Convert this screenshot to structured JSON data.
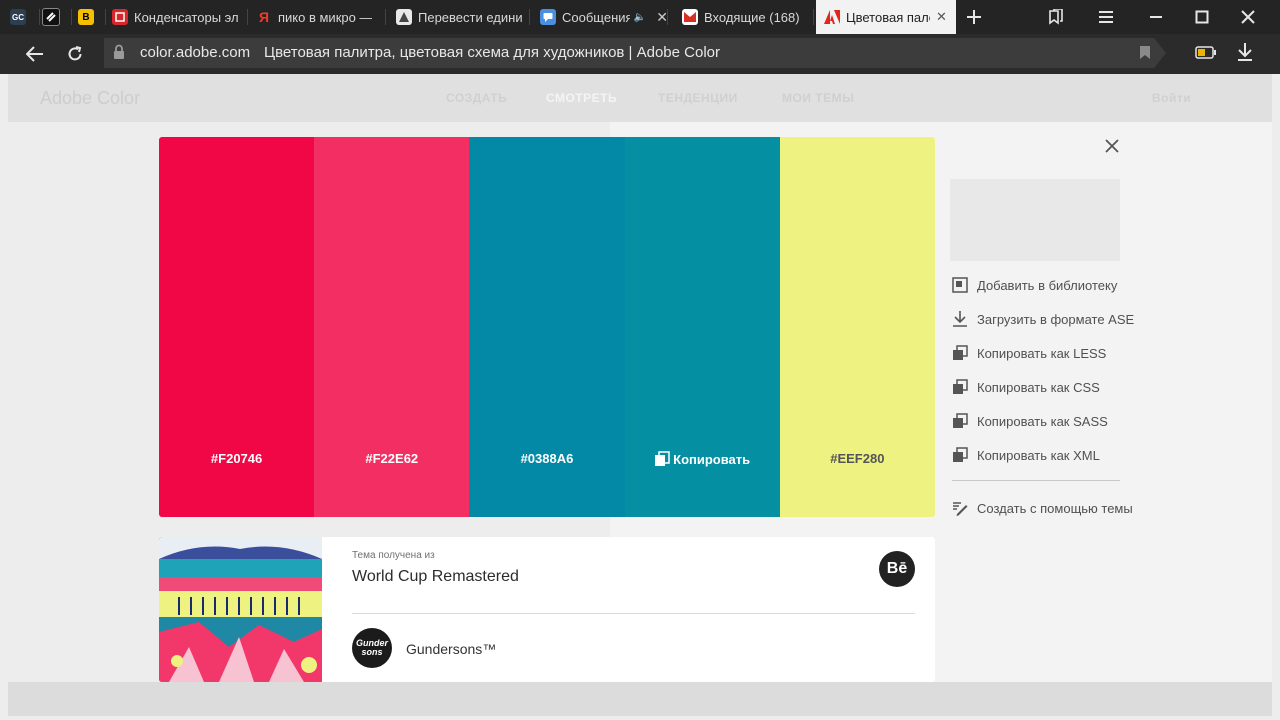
{
  "browser": {
    "tabs": [
      {
        "label": "",
        "icon": "gc-favicon-icon"
      },
      {
        "label": "",
        "icon": "link-favicon-icon"
      },
      {
        "label": "",
        "icon": "b-favicon-icon"
      },
      {
        "label": "Конденсаторы эл",
        "icon": "chip-favicon-icon"
      },
      {
        "label": "пико в микро —",
        "icon": "yandex-favicon-icon"
      },
      {
        "label": "Перевести едини",
        "icon": "translate-favicon-icon"
      },
      {
        "label": "Сообщения",
        "icon": "messages-favicon-icon"
      },
      {
        "label": "Входящие (168)",
        "icon": "gmail-favicon-icon"
      },
      {
        "label": "Цветовая пале",
        "icon": "adobe-favicon-icon"
      }
    ],
    "fav_glyphs": {
      "gc": "GC",
      "b": "B",
      "ya": "Я",
      "be": "Bē"
    },
    "domain": "color.adobe.com",
    "page_title": "Цветовая палитра, цветовая схема для художников | Adobe Color"
  },
  "site": {
    "logo": "Adobe Color",
    "nav": [
      "СОЗДАТЬ",
      "СМОТРЕТЬ",
      "ТЕНДЕНЦИИ",
      "МОИ ТЕМЫ"
    ],
    "login": "Войти"
  },
  "palette": {
    "swatches": [
      {
        "hex": "#F20746",
        "color": "#F20746",
        "label_dark": false
      },
      {
        "hex": "#F22E62",
        "color": "#F22E62",
        "label_dark": false
      },
      {
        "hex": "#0388A6",
        "color": "#0388A6",
        "label_dark": false
      },
      {
        "hex": "Копировать",
        "color": "#048FA2",
        "label_dark": false
      },
      {
        "hex": "#EEF280",
        "color": "#EEF280",
        "label_dark": true
      }
    ]
  },
  "actions": [
    {
      "label": "Добавить в библиотеку",
      "icon": "library-add-icon"
    },
    {
      "label": "Загрузить в формате ASE",
      "icon": "download-icon"
    },
    {
      "label": "Копировать как LESS",
      "icon": "copy-icon"
    },
    {
      "label": "Копировать как CSS",
      "icon": "copy-icon"
    },
    {
      "label": "Копировать как SASS",
      "icon": "copy-icon"
    },
    {
      "label": "Копировать как XML",
      "icon": "copy-icon"
    },
    {
      "label": "Создать с помощью темы",
      "icon": "edit-theme-icon"
    }
  ],
  "source": {
    "caption": "Тема получена из",
    "title": "World Cup Remastered",
    "author": "Gundersons™",
    "avatar_text": "Gunder sons"
  },
  "colors": {
    "accent": "#F20746",
    "teal": "#0388A6",
    "yellow": "#EEF280"
  }
}
